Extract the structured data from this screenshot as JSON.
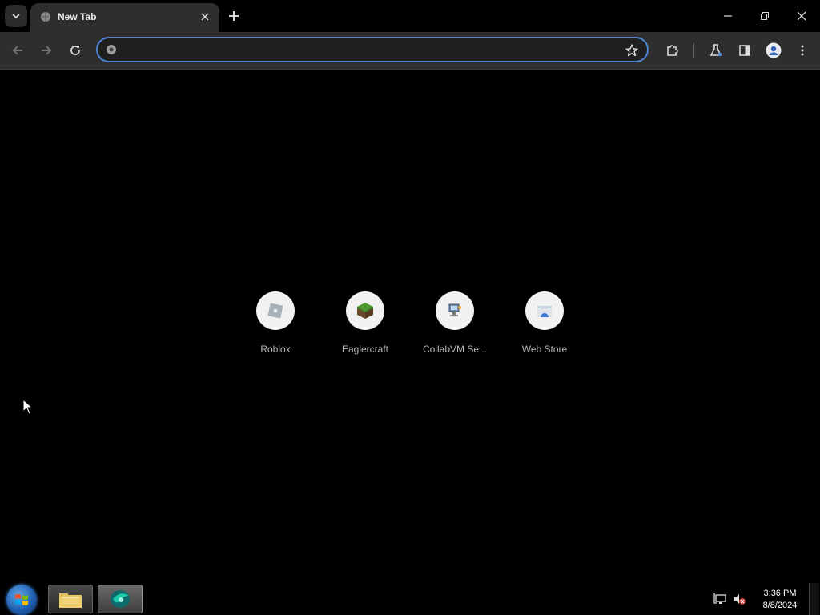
{
  "browser": {
    "tab": {
      "title": "New Tab"
    },
    "omnibox": {
      "value": "",
      "placeholder": ""
    }
  },
  "shortcuts": [
    {
      "label": "Roblox",
      "icon": "roblox-icon"
    },
    {
      "label": "Eaglercraft",
      "icon": "grass-block-icon"
    },
    {
      "label": "CollabVM Se...",
      "icon": "computer-icon"
    },
    {
      "label": "Web Store",
      "icon": "web-store-icon"
    }
  ],
  "taskbar": {
    "time": "3:36 PM",
    "date": "8/8/2024"
  },
  "colors": {
    "background": "#000000",
    "toolbar": "#2e2e2e",
    "omnibox_border": "#4f83d6",
    "shortcut_circle": "#f1f1f1"
  }
}
